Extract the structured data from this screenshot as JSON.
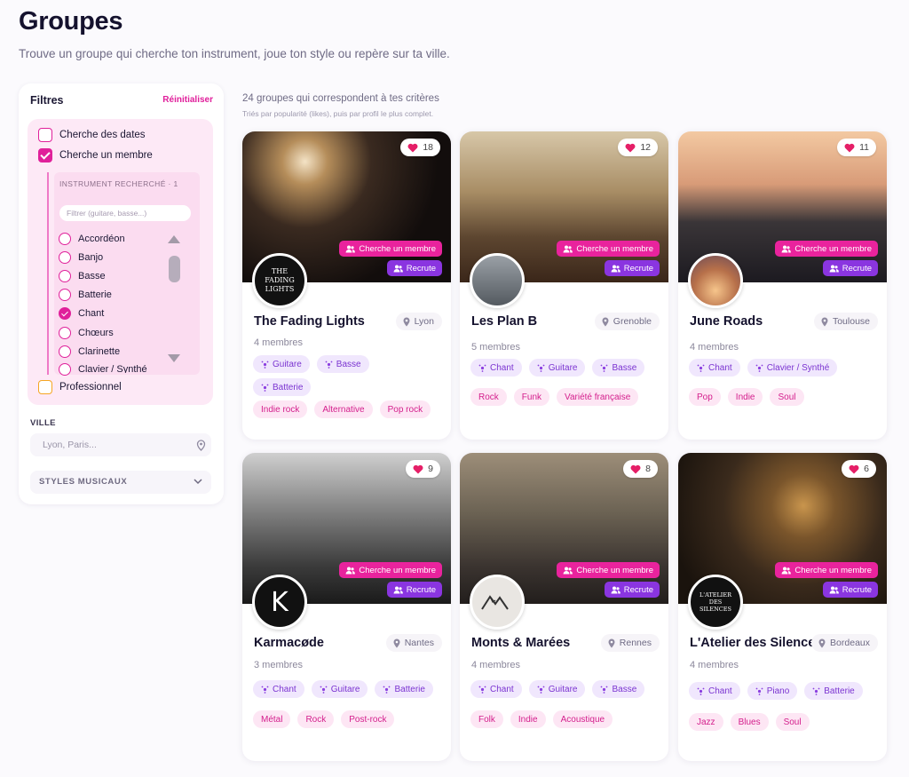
{
  "header": {
    "title": "Groupes",
    "subtitle": "Trouve un groupe qui cherche ton instrument, joue ton style ou repère sur ta ville."
  },
  "filters": {
    "title": "Filtres",
    "reset": "Réinitialiser",
    "opt_dates": "Cherche des dates",
    "opt_membre": "Cherche un membre",
    "opt_pro": "Professionnel",
    "instrument_title": "Instrument recherché · 1",
    "instrument_placeholder": "Filtrer (guitare, basse...)",
    "instruments": [
      {
        "label": "Accordéon",
        "checked": false
      },
      {
        "label": "Banjo",
        "checked": false
      },
      {
        "label": "Basse",
        "checked": false
      },
      {
        "label": "Batterie",
        "checked": false
      },
      {
        "label": "Chant",
        "checked": true
      },
      {
        "label": "Chœurs",
        "checked": false
      },
      {
        "label": "Clarinette",
        "checked": false
      },
      {
        "label": "Clavier / Synthé",
        "checked": false
      }
    ],
    "ville_title": "VILLE",
    "ville_placeholder": "Lyon, Paris...",
    "styles_title": "STYLES MUSICAUX"
  },
  "results": {
    "count": "24 groupes qui correspondent à tes critères",
    "sort": "Triés par popularité (likes), puis par profil le plus complet."
  },
  "badges": {
    "cherche": "Cherche un membre",
    "recrute": "Recrute"
  },
  "colors": {
    "accent_pink": "#e9239d",
    "accent_purple": "#8a35e0"
  },
  "groups": [
    {
      "name": "The Fading Lights",
      "city": "Lyon",
      "likes": "18",
      "members": "4 membres",
      "avatar_text": "THE FADING LIGHTS",
      "instruments": [
        "Guitare",
        "Basse",
        "Batterie"
      ],
      "styles": [
        "Indie rock",
        "Alternative",
        "Pop rock"
      ]
    },
    {
      "name": "Les Plan B",
      "city": "Grenoble",
      "likes": "12",
      "members": "5 membres",
      "avatar_text": "",
      "instruments": [
        "Chant",
        "Guitare",
        "Basse"
      ],
      "styles": [
        "Rock",
        "Funk",
        "Variété française"
      ]
    },
    {
      "name": "June Roads",
      "city": "Toulouse",
      "likes": "11",
      "members": "4 membres",
      "avatar_text": "",
      "instruments": [
        "Chant",
        "Clavier / Synthé"
      ],
      "styles": [
        "Pop",
        "Indie",
        "Soul"
      ]
    },
    {
      "name": "Karmacøde",
      "city": "Nantes",
      "likes": "9",
      "members": "3 membres",
      "avatar_text": "K",
      "instruments": [
        "Chant",
        "Guitare",
        "Batterie"
      ],
      "styles": [
        "Métal",
        "Rock",
        "Post-rock"
      ]
    },
    {
      "name": "Monts & Marées",
      "city": "Rennes",
      "likes": "8",
      "members": "4 membres",
      "avatar_text": "",
      "instruments": [
        "Chant",
        "Guitare",
        "Basse"
      ],
      "styles": [
        "Folk",
        "Indie",
        "Acoustique"
      ]
    },
    {
      "name": "L'Atelier des Silences",
      "city": "Bordeaux",
      "likes": "6",
      "members": "4 membres",
      "avatar_text": "L'ATELIER DES SILENCES",
      "instruments": [
        "Chant",
        "Piano",
        "Batterie"
      ],
      "styles": [
        "Jazz",
        "Blues",
        "Soul"
      ]
    }
  ]
}
